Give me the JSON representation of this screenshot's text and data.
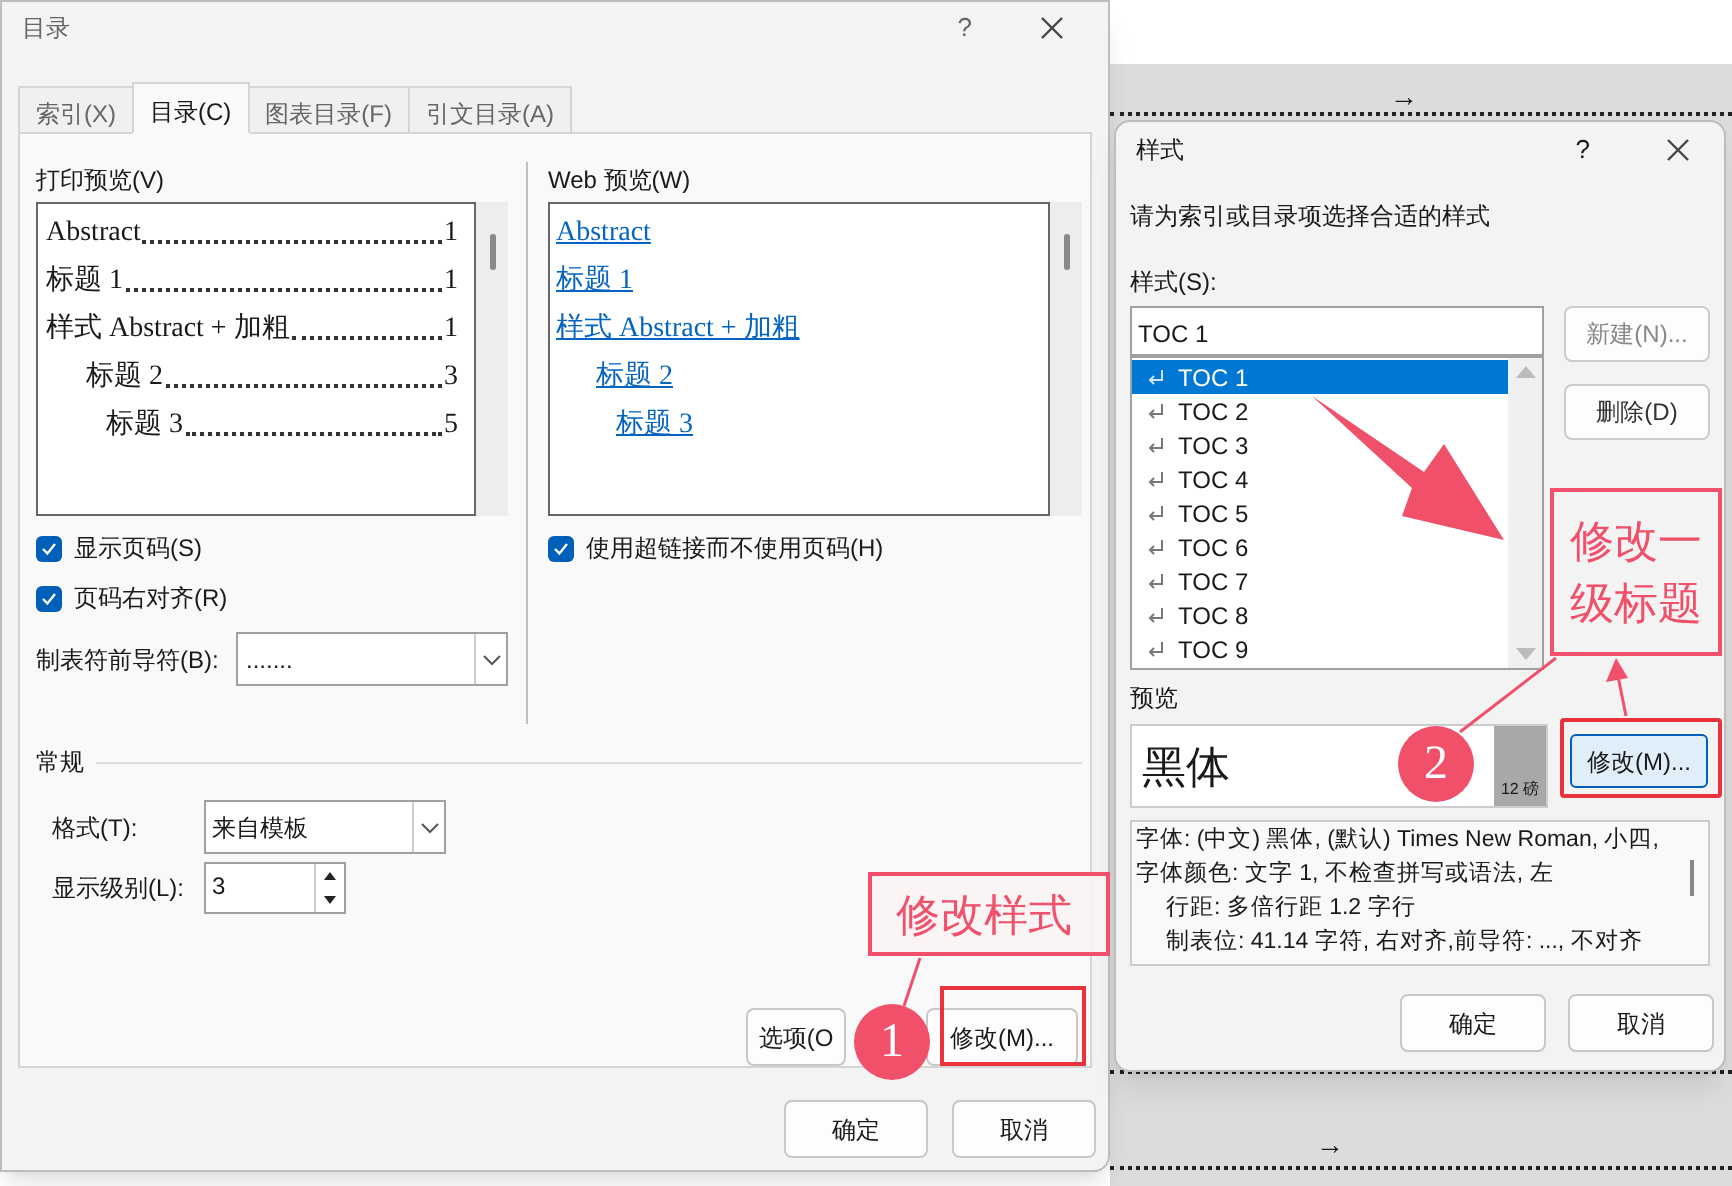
{
  "background": {
    "marks": [
      "→",
      "→"
    ]
  },
  "toc_dialog": {
    "title": "目录",
    "help": "?",
    "tabs": [
      {
        "label": "索引(X)",
        "selected": false
      },
      {
        "label": "目录(C)",
        "selected": true
      },
      {
        "label": "图表目录(F)",
        "selected": false
      },
      {
        "label": "引文目录(A)",
        "selected": false
      }
    ],
    "print_preview": {
      "label": "打印预览(V)",
      "entries": [
        {
          "text": "Abstract",
          "page": "1"
        },
        {
          "text": "标题  1",
          "page": "1"
        },
        {
          "text": "样式  Abstract +  加粗",
          "page": "1",
          "children": [
            {
              "text": "标题  2",
              "page": "3",
              "children": [
                {
                  "text": "标题  3",
                  "page": "5"
                }
              ]
            }
          ]
        }
      ]
    },
    "show_page_numbers": {
      "label": "显示页码(S)",
      "checked": true
    },
    "right_align": {
      "label": "页码右对齐(R)",
      "checked": true
    },
    "tab_leader": {
      "label": "制表符前导符(B):",
      "value": "......."
    },
    "web_preview": {
      "label": "Web 预览(W)",
      "entries": [
        {
          "text": "Abstract"
        },
        {
          "text": "标题  1"
        },
        {
          "text": "样式  Abstract +  加粗",
          "children": [
            {
              "text": "标题  2",
              "children": [
                {
                  "text": "标题  3"
                }
              ]
            }
          ]
        }
      ]
    },
    "use_hyperlinks": {
      "label": "使用超链接而不使用页码(H)",
      "checked": true
    },
    "general": {
      "label": "常规",
      "format": {
        "label": "格式(T):",
        "value": "来自模板"
      },
      "levels": {
        "label": "显示级别(L):",
        "value": "3"
      }
    },
    "options_button": "选项(O",
    "modify_button": "修改(M)...",
    "ok_button": "确定",
    "cancel_button": "取消"
  },
  "style_dialog": {
    "title": "样式",
    "help": "?",
    "prompt": "请为索引或目录项选择合适的样式",
    "styles_label": "样式(S):",
    "style_value": "TOC 1",
    "styles": [
      {
        "name": "TOC 1",
        "selected": true
      },
      {
        "name": "TOC 2",
        "selected": false
      },
      {
        "name": "TOC 3",
        "selected": false
      },
      {
        "name": "TOC 4",
        "selected": false
      },
      {
        "name": "TOC 5",
        "selected": false
      },
      {
        "name": "TOC 6",
        "selected": false
      },
      {
        "name": "TOC 7",
        "selected": false
      },
      {
        "name": "TOC 8",
        "selected": false
      },
      {
        "name": "TOC 9",
        "selected": false
      }
    ],
    "new_button": {
      "label": "新建(N)...",
      "disabled": true
    },
    "delete_button": {
      "label": "删除(D)",
      "disabled": false
    },
    "preview_label": "预览",
    "preview_text": "黑体",
    "preview_size": "12 磅",
    "description": {
      "text": "字体: (中文) 黑体, (默认) Times New Roman, 小四, 字体颜色: 文字 1, 不检查拼写或语法, 左",
      "details": [
        "行距: 多倍行距 1.2 字行",
        "制表位:  41.14 字符, 右对齐,前导符: ..., 不对齐"
      ]
    },
    "modify_button": "修改(M)...",
    "ok_button": "确定",
    "cancel_button": "取消"
  },
  "annotations": [
    {
      "number": "1",
      "text": "修改样式"
    },
    {
      "number": "2",
      "text": "修改一级标题"
    }
  ]
}
